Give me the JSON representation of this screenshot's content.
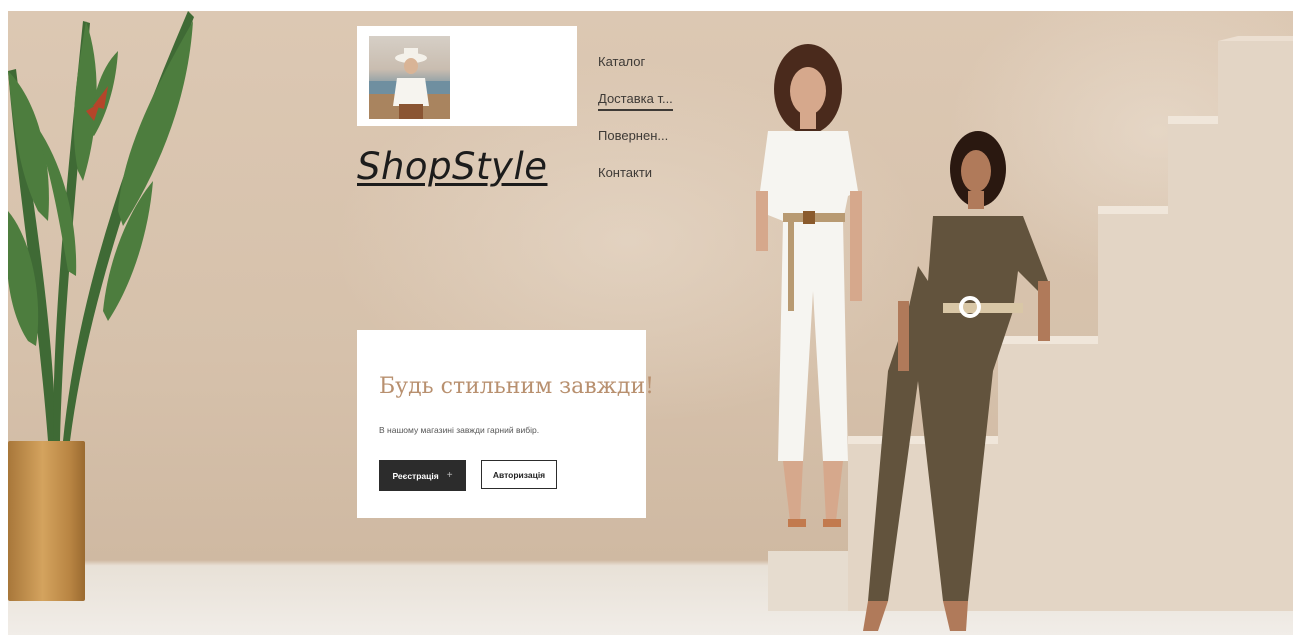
{
  "header": {
    "brand": "ShopStyle"
  },
  "nav": {
    "items": [
      {
        "label": "Каталог"
      },
      {
        "label": "Доставка т..."
      },
      {
        "label": "Повернен..."
      },
      {
        "label": "Контакти"
      }
    ]
  },
  "promo": {
    "title": "Будь стильним завжди!",
    "subtitle": "В нашому магазині завжди гарний вибір.",
    "register_label": "Реєстрація",
    "register_icon": "+",
    "login_label": "Авторизація"
  },
  "colors": {
    "accent_title": "#b8906f",
    "primary_button": "#2c2c2c",
    "wall": "#d6c1ab"
  }
}
